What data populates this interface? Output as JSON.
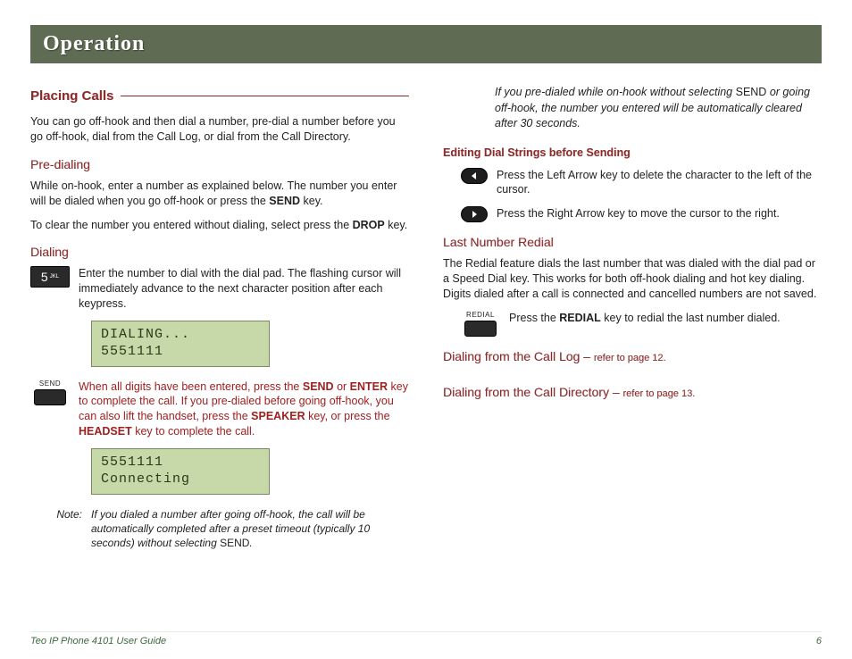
{
  "banner": {
    "title": "Operation"
  },
  "left": {
    "section": "Placing Calls",
    "intro": "You can go off-hook and then dial a number, pre-dial a number before you go off-hook, dial from the Call Log, or dial from the Call Directory.",
    "predial": {
      "heading": "Pre-dialing",
      "p1a": "While on-hook, enter a number as explained below. The number you enter will be dialed when you go off-hook or press the ",
      "p1b": "SEND",
      "p1c": " key.",
      "p2a": "To clear the number you entered without dialing, select press the ",
      "p2b": "DROP",
      "p2c": " key."
    },
    "dialing": {
      "heading": "Dialing",
      "key_digit": "5",
      "key_letters": "JKL",
      "enter_txt": "Enter the number to dial with the dial pad. The flashing cursor will immediately advance to the next character position after each keypress.",
      "lcd1": "DIALING...\n5551111",
      "send_label": "SEND",
      "send_parts": {
        "a": "When all digits have been entered, press the ",
        "b": "SEND",
        "c": " or ",
        "d": "ENTER",
        "e": " key to complete the call. If you pre-dialed before going off-hook, you can also lift the handset, press the ",
        "f": "SPEAKER",
        "g": " key, or press the ",
        "h": "HEADSET",
        "i": " key to complete the call."
      },
      "lcd2": "5551111\nConnecting",
      "note_label": "Note:",
      "note_parts": {
        "a": "If you dialed a number after going off-hook, the call will be automatically completed after a preset timeout (typically 10 seconds) without selecting ",
        "b": "SEND",
        "c": "."
      }
    }
  },
  "right": {
    "cont_parts": {
      "a": "If you pre-dialed while on-hook without selecting ",
      "b": "SEND",
      "c": " or going off-hook, the number you entered will be automatically cleared after 30 seconds."
    },
    "edit": {
      "heading": "Editing Dial Strings before Sending",
      "left_txt": "Press the Left Arrow key to delete the character to the left of the cursor.",
      "right_txt": "Press the Right Arrow key to move the cursor to the right."
    },
    "redial": {
      "heading": "Last Number Redial",
      "p1": "The Redial feature dials the last number that was dialed with the dial pad or a Speed Dial key. This works for both off-hook dialing and hot key dialing. Digits dialed after a call is connected and cancelled numbers are not saved.",
      "key_label": "REDIAL",
      "txt_a": "Press the ",
      "txt_b": "REDIAL",
      "txt_c": " key to redial the last number dialed."
    },
    "log": {
      "heading": "Dialing from the Call Log – ",
      "ref": "refer to page 12."
    },
    "dir": {
      "heading": "Dialing from the Call Directory – ",
      "ref": "refer to page 13."
    }
  },
  "footer": {
    "guide": "Teo IP Phone 4101 User Guide",
    "page": "6"
  }
}
